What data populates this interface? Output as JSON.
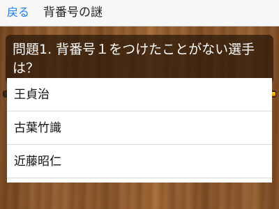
{
  "nav": {
    "back_label": "戻る",
    "title": "背番号の謎"
  },
  "question": {
    "text": "問題1. 背番号１をつけたことがない選手は？"
  },
  "progress": {
    "fraction": 0.8
  },
  "answers": [
    {
      "label": "王貞治"
    },
    {
      "label": "古葉竹識"
    },
    {
      "label": "近藤昭仁"
    }
  ],
  "colors": {
    "accent": "#1a7cf5",
    "progress": "#f2a600",
    "wood": "#8c5629"
  }
}
